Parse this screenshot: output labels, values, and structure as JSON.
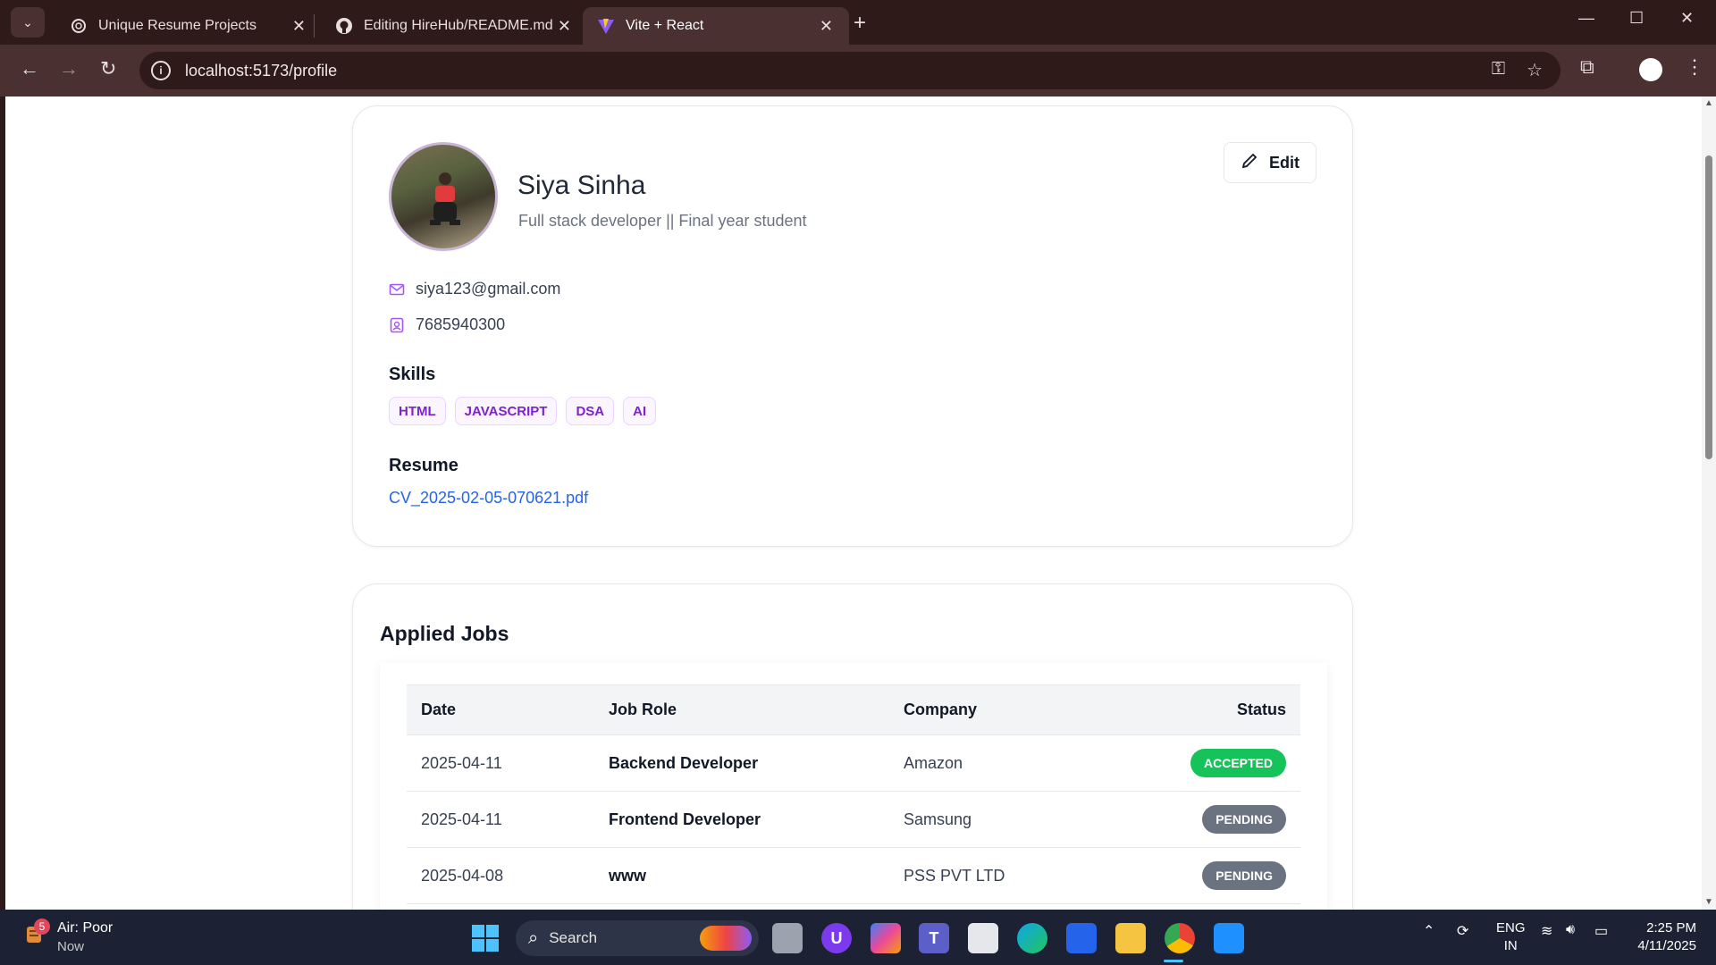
{
  "browser": {
    "tabs": [
      {
        "title": "Unique Resume Projects",
        "icon": "chatgpt-icon"
      },
      {
        "title": "Editing HireHub/README.md at",
        "icon": "github-icon"
      },
      {
        "title": "Vite + React",
        "icon": "vite-icon",
        "active": true
      }
    ],
    "new_tab": "+",
    "url": "localhost:5173/profile"
  },
  "profile": {
    "name": "Siya Sinha",
    "tagline": "Full stack developer || Final year student",
    "edit_label": "Edit",
    "email": "siya123@gmail.com",
    "phone": "7685940300",
    "skills_heading": "Skills",
    "skills": [
      "HTML",
      "JAVASCRIPT",
      "DSA",
      "AI"
    ],
    "resume_heading": "Resume",
    "resume_file": "CV_2025-02-05-070621.pdf"
  },
  "applied_jobs": {
    "title": "Applied Jobs",
    "columns": [
      "Date",
      "Job Role",
      "Company",
      "Status"
    ],
    "rows": [
      {
        "date": "2025-04-11",
        "role": "Backend Developer",
        "company": "Amazon",
        "status": "ACCEPTED"
      },
      {
        "date": "2025-04-11",
        "role": "Frontend Developer",
        "company": "Samsung",
        "status": "PENDING"
      },
      {
        "date": "2025-04-08",
        "role": "www",
        "company": "PSS PVT LTD",
        "status": "PENDING"
      }
    ],
    "status_colors": {
      "ACCEPTED": "#16c25a",
      "PENDING": "#6b7280"
    }
  },
  "taskbar": {
    "weather_badge": "5",
    "weather_title": "Air: Poor",
    "weather_sub": "Now",
    "search_label": "Search",
    "lang_line1": "ENG",
    "lang_line2": "IN",
    "time": "2:25 PM",
    "date": "4/11/2025"
  },
  "colors": {
    "titlebar": "#2f1a1a",
    "toolbar": "#4a3030",
    "accent_purple": "#a855f7",
    "link_blue": "#2563eb"
  }
}
